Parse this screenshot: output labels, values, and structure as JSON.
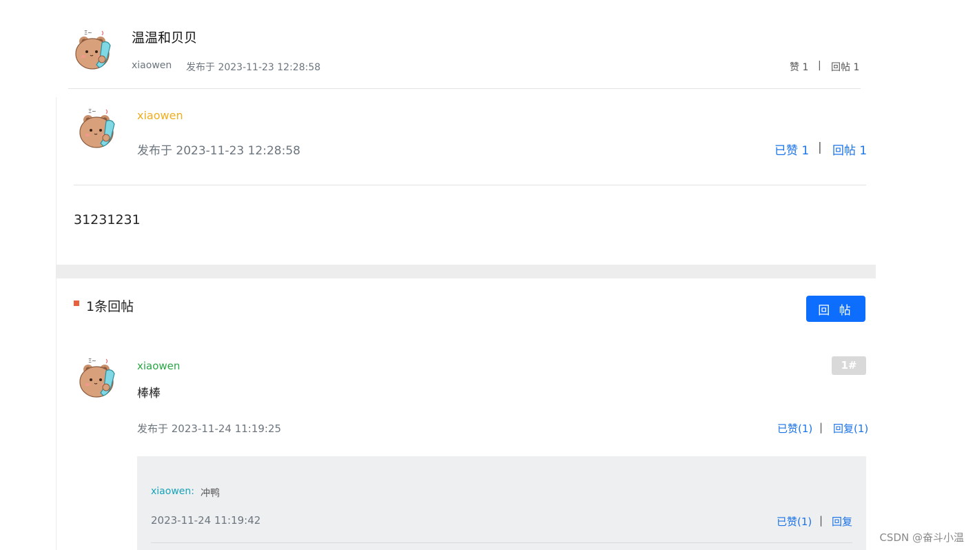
{
  "thread": {
    "title": "温温和贝贝",
    "author": "xiaowen",
    "published": "发布于 2023-11-23 12:28:58",
    "like_label": "赞 1",
    "separator": "|",
    "reply_label": "回帖 1"
  },
  "main_post": {
    "author": "xiaowen",
    "published": "发布于 2023-11-23 12:28:58",
    "liked_label": "已赞 1",
    "separator": "|",
    "reply_label": "回帖 1",
    "content": "31231231"
  },
  "replies_section": {
    "heading": "1条回帖",
    "reply_button": "回 帖"
  },
  "replies": [
    {
      "author": "xiaowen",
      "content": "棒棒",
      "floor": "1#",
      "published": "发布于 2023-11-24 11:19:25",
      "liked_label": "已赞(1)",
      "separator": "|",
      "reply_label": "回复(1)",
      "comments": [
        {
          "author": "xiaowen:",
          "content": "冲鸭",
          "time": "2023-11-24 11:19:42",
          "liked_label": "已赞(1)",
          "separator": "|",
          "reply_label": "回复"
        }
      ]
    }
  ],
  "watermark": "CSDN @奋斗小温",
  "colors": {
    "author_orange": "#f0ad1d",
    "author_green": "#28a745",
    "link_blue": "#1a73e8",
    "button_blue": "#0d6efd",
    "marker_red": "#e8613c"
  }
}
